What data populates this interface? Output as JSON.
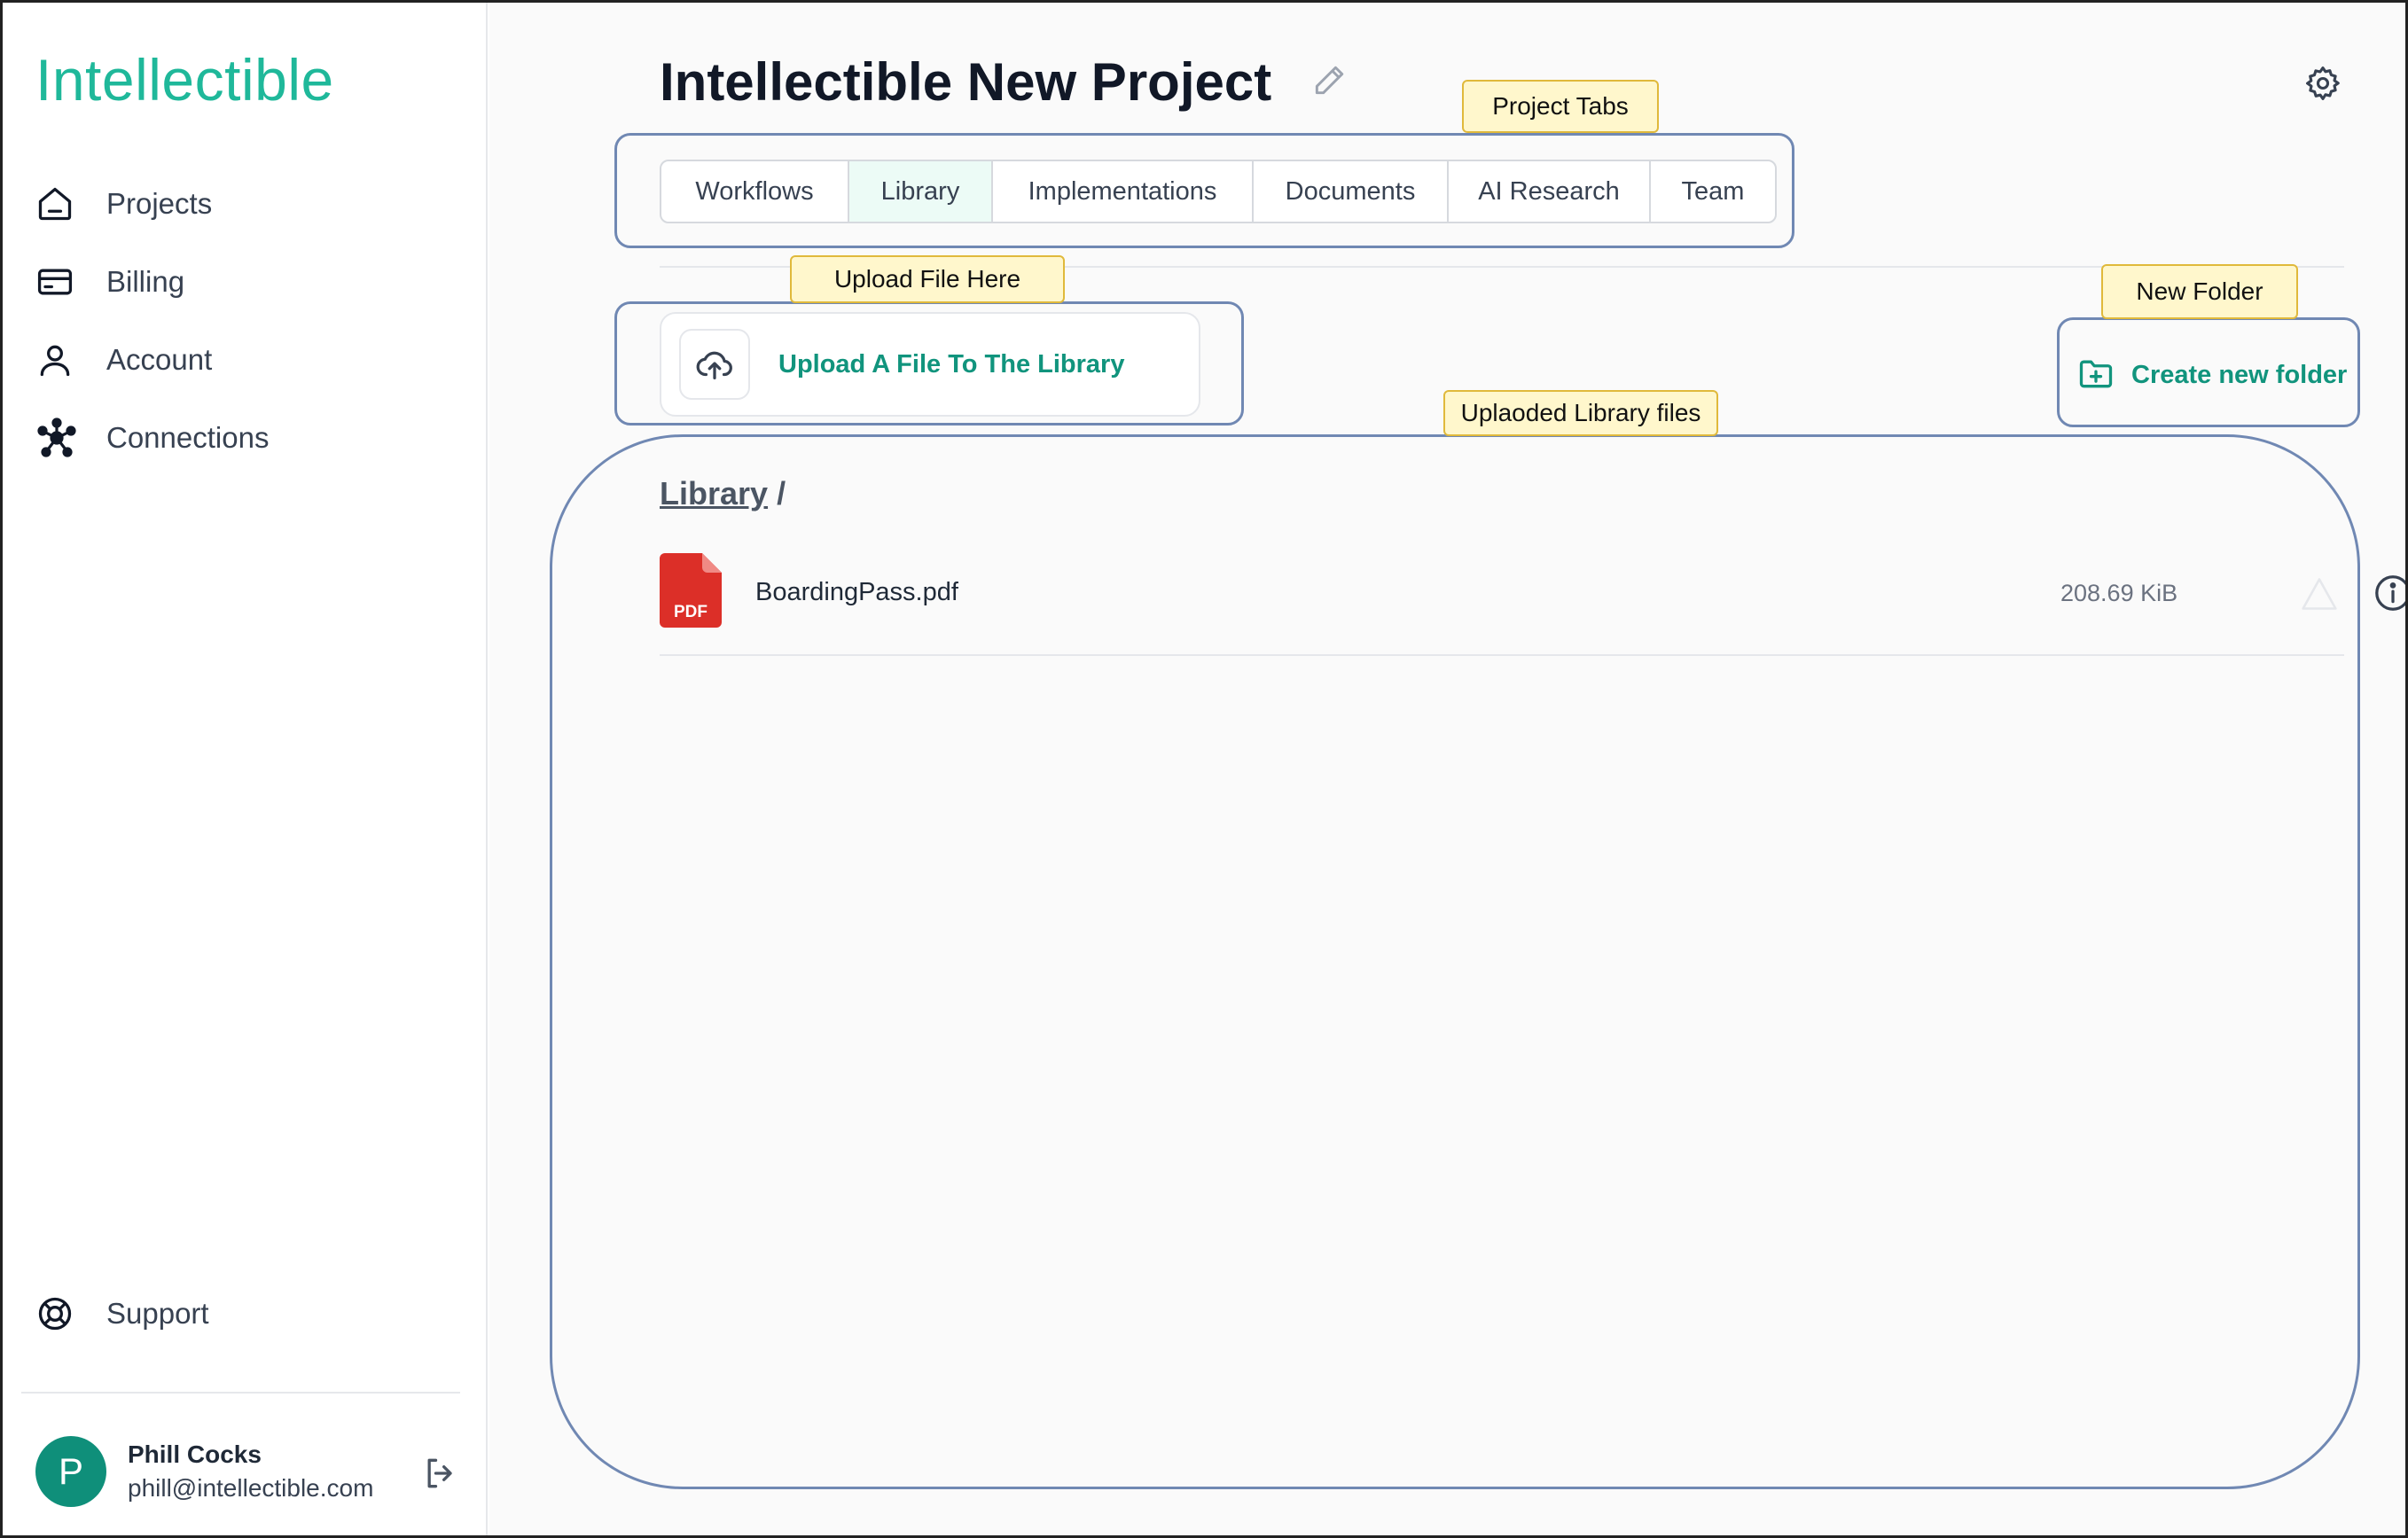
{
  "app": {
    "name": "Intellectible"
  },
  "sidebar": {
    "items": [
      {
        "label": "Projects",
        "icon": "home-icon"
      },
      {
        "label": "Billing",
        "icon": "credit-card-icon"
      },
      {
        "label": "Account",
        "icon": "user-icon"
      },
      {
        "label": "Connections",
        "icon": "network-icon"
      }
    ],
    "support": {
      "label": "Support",
      "icon": "lifebuoy-icon"
    },
    "user": {
      "initial": "P",
      "name": "Phill Cocks",
      "email": "phill@intellectible.com"
    }
  },
  "header": {
    "title": "Intellectible New Project"
  },
  "tabs": [
    {
      "label": "Workflows",
      "active": false
    },
    {
      "label": "Library",
      "active": true
    },
    {
      "label": "Implementations",
      "active": false
    },
    {
      "label": "Documents",
      "active": false
    },
    {
      "label": "AI Research",
      "active": false
    },
    {
      "label": "Team",
      "active": false
    }
  ],
  "upload": {
    "label": "Upload A File To The Library"
  },
  "new_folder": {
    "label": "Create new folder"
  },
  "breadcrumb": {
    "root": "Library",
    "separator": "/"
  },
  "files": [
    {
      "name": "BoardingPass.pdf",
      "size": "208.69 KiB",
      "type": "PDF"
    }
  ],
  "annotations": {
    "project_tabs": "Project Tabs",
    "upload_file": "Upload File Here",
    "new_folder": "New Folder",
    "uploaded_files": "Uplaoded Library files"
  },
  "colors": {
    "brand": "#1fb89a",
    "accent": "#11947d",
    "annotation_border": "#7088b3",
    "pdf_red": "#dc2f28"
  }
}
